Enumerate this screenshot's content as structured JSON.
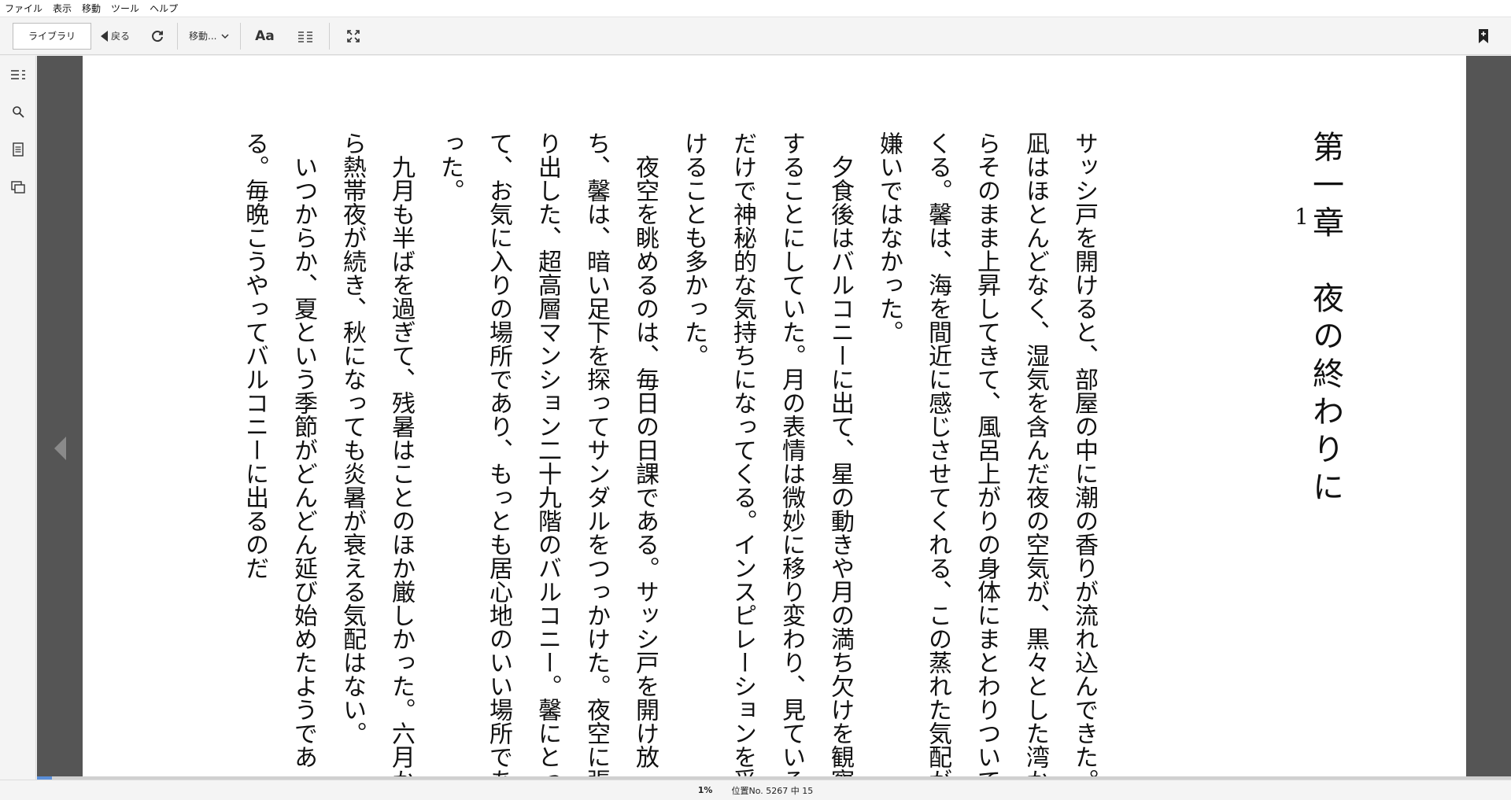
{
  "menu": {
    "items": [
      "ファイル",
      "表示",
      "移動",
      "ツール",
      "ヘルプ"
    ]
  },
  "toolbar": {
    "library_label": "ライブラリ",
    "back_label": "戻る",
    "goto_label": "移動...",
    "font_label": "Aa"
  },
  "book": {
    "chapter_title": "第一章　夜の終わりに",
    "section_number": "1",
    "paragraphs": [
      "サッシ戸を開けると、部屋の中に潮の香りが流れ込んできた。凪はほとんどなく、湿気を含んだ夜の空気が、黒々とした湾からそのまま上昇してきて、風呂上がりの身体にまとわりついてくる。馨は、海を間近に感じさせてくれる、この蒸れた気配が嫌いではなかった。",
      "夕食後はバルコニーに出て、星の動きや月の満ち欠けを観察することにしていた。月の表情は微妙に移り変わり、見ているだけで神秘的な気持ちになってくる。インスピレーションを受けることも多かった。",
      "夜空を眺めるのは、毎日の日課である。サッシ戸を開け放ち、馨は、暗い足下を探ってサンダルをつっかけた。夜空に張り出した、超高層マンション二十九階のバルコニー。馨にとって、お気に入りの場所であり、もっとも居心地のいい場所であった。",
      "九月も半ばを過ぎて、残暑はことのほか厳しかった。六月から熱帯夜が続き、秋になっても炎暑が衰える気配はない。",
      "いつからか、夏という季節がどんどん延び始めたようである。毎晩こうやってバルコニーに出るのだ"
    ]
  },
  "status": {
    "percent": "1%",
    "location": "位置No. 5267 中 15",
    "progress_fraction": 0.01
  }
}
